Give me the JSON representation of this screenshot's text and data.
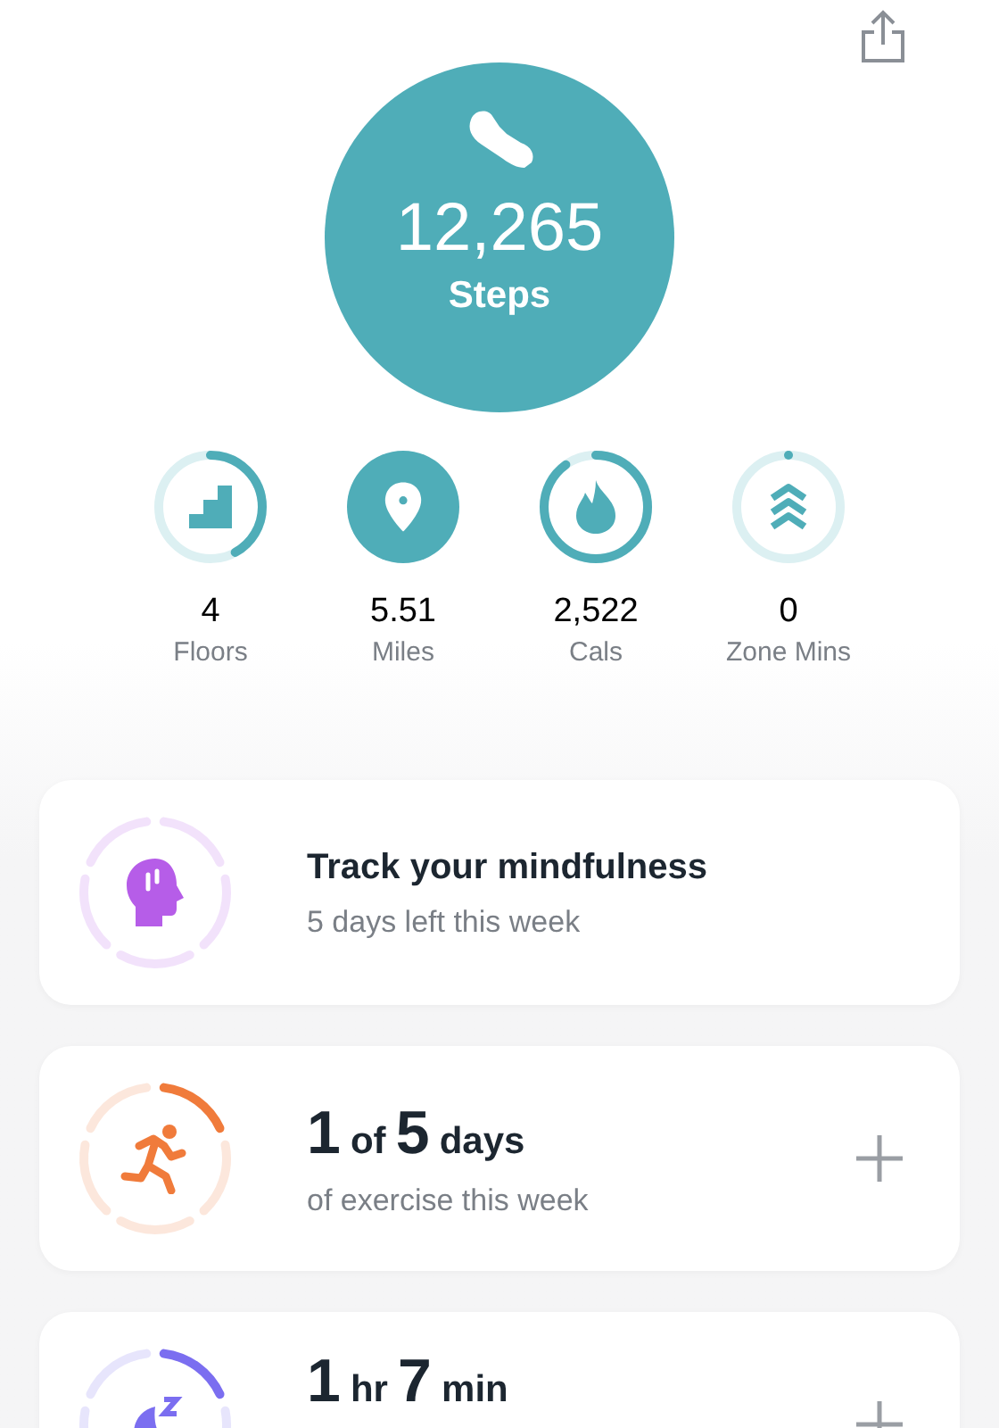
{
  "steps": {
    "value": "12,265",
    "label": "Steps"
  },
  "stats": [
    {
      "kind": "stairs",
      "value": "4",
      "label": "Floors",
      "completed": false,
      "level": 0.42
    },
    {
      "kind": "pin",
      "value": "5.51",
      "label": "Miles",
      "completed": true
    },
    {
      "kind": "flame",
      "value": "2,522",
      "label": "Cals",
      "completed": false,
      "level": 0.9
    },
    {
      "kind": "chevrons",
      "value": "0",
      "label": "Zone Mins",
      "completed": false,
      "level": 0
    }
  ],
  "cards": [
    {
      "kind": "mindfulness",
      "color": "#b65de8",
      "level": 0,
      "title": [
        {
          "kind": "text",
          "text": "Track your mindfulness"
        }
      ],
      "subtitle": "5 days left this week",
      "add_button": false
    },
    {
      "kind": "exercise",
      "color": "#f07b3b",
      "level": 0.2,
      "title": [
        {
          "kind": "number",
          "text": "1"
        },
        {
          "kind": "unit",
          "text": "of"
        },
        {
          "kind": "number",
          "text": "5"
        },
        {
          "kind": "unit",
          "text": "days"
        }
      ],
      "subtitle": "of exercise this week",
      "add_button": true
    },
    {
      "kind": "sleep",
      "color": "#7b6ef0",
      "level": 0.2,
      "title": [
        {
          "kind": "number",
          "text": "1"
        },
        {
          "kind": "unit",
          "text": "hr"
        },
        {
          "kind": "number",
          "text": "7"
        },
        {
          "kind": "unit",
          "text": "min"
        }
      ],
      "add_button": true
    }
  ]
}
